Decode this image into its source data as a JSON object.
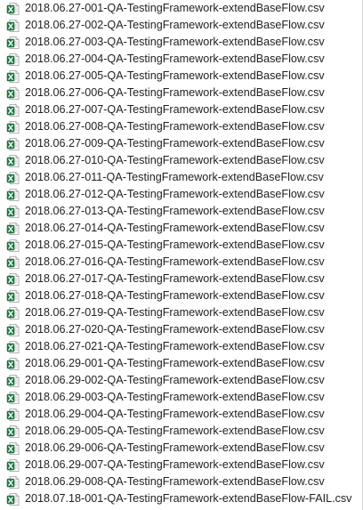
{
  "file_icon": "excel-csv-icon",
  "colors": {
    "excel_green": "#1e7a45",
    "excel_dark_green": "#0f5a30",
    "text": "#1f1f1f"
  },
  "files": [
    "2018.06.27-001-QA-TestingFramework-extendBaseFlow.csv",
    "2018.06.27-002-QA-TestingFramework-extendBaseFlow.csv",
    "2018.06.27-003-QA-TestingFramework-extendBaseFlow.csv",
    "2018.06.27-004-QA-TestingFramework-extendBaseFlow.csv",
    "2018.06.27-005-QA-TestingFramework-extendBaseFlow.csv",
    "2018.06.27-006-QA-TestingFramework-extendBaseFlow.csv",
    "2018.06.27-007-QA-TestingFramework-extendBaseFlow.csv",
    "2018.06.27-008-QA-TestingFramework-extendBaseFlow.csv",
    "2018.06.27-009-QA-TestingFramework-extendBaseFlow.csv",
    "2018.06.27-010-QA-TestingFramework-extendBaseFlow.csv",
    "2018.06.27-011-QA-TestingFramework-extendBaseFlow.csv",
    "2018.06.27-012-QA-TestingFramework-extendBaseFlow.csv",
    "2018.06.27-013-QA-TestingFramework-extendBaseFlow.csv",
    "2018.06.27-014-QA-TestingFramework-extendBaseFlow.csv",
    "2018.06.27-015-QA-TestingFramework-extendBaseFlow.csv",
    "2018.06.27-016-QA-TestingFramework-extendBaseFlow.csv",
    "2018.06.27-017-QA-TestingFramework-extendBaseFlow.csv",
    "2018.06.27-018-QA-TestingFramework-extendBaseFlow.csv",
    "2018.06.27-019-QA-TestingFramework-extendBaseFlow.csv",
    "2018.06.27-020-QA-TestingFramework-extendBaseFlow.csv",
    "2018.06.27-021-QA-TestingFramework-extendBaseFlow.csv",
    "2018.06.29-001-QA-TestingFramework-extendBaseFlow.csv",
    "2018.06.29-002-QA-TestingFramework-extendBaseFlow.csv",
    "2018.06.29-003-QA-TestingFramework-extendBaseFlow.csv",
    "2018.06.29-004-QA-TestingFramework-extendBaseFlow.csv",
    "2018.06.29-005-QA-TestingFramework-extendBaseFlow.csv",
    "2018.06.29-006-QA-TestingFramework-extendBaseFlow.csv",
    "2018.06.29-007-QA-TestingFramework-extendBaseFlow.csv",
    "2018.06.29-008-QA-TestingFramework-extendBaseFlow.csv",
    "2018.07.18-001-QA-TestingFramework-extendBaseFlow-FAIL.csv"
  ]
}
